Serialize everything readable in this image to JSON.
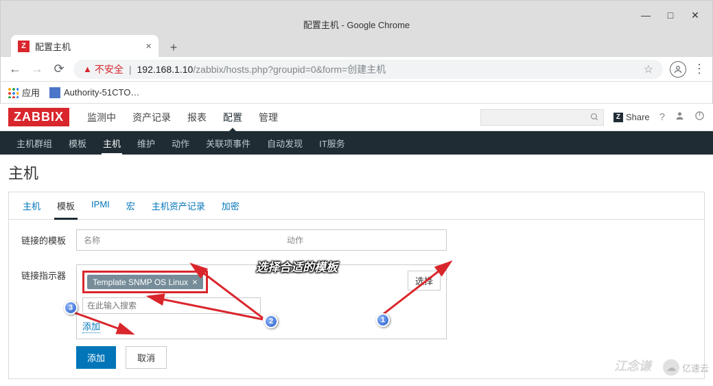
{
  "chrome": {
    "window_title": "配置主机 - Google Chrome",
    "tab_title": "配置主机",
    "tab_favicon_letter": "Z",
    "insecure_label": "不安全",
    "url_host": "192.168.1.10",
    "url_path": "/zabbix/hosts.php?groupid=0&form=创建主机",
    "apps_label": "应用",
    "bookmark_1": "Authority-51CTO…"
  },
  "zabbix": {
    "logo": "ZABBIX",
    "top_menu": [
      "监测中",
      "资产记录",
      "报表",
      "配置",
      "管理"
    ],
    "top_menu_active_index": 3,
    "share_label": "Share",
    "sub_menu": [
      "主机群组",
      "模板",
      "主机",
      "维护",
      "动作",
      "关联项事件",
      "自动发现",
      "IT服务"
    ],
    "sub_menu_active_index": 2,
    "page_title": "主机",
    "card_tabs": [
      "主机",
      "模板",
      "IPMI",
      "宏",
      "主机资产记录",
      "加密"
    ],
    "card_tabs_active_index": 1,
    "linked_label": "链接的模板",
    "linked_cols": {
      "name": "名称",
      "action": "动作"
    },
    "indicator_label": "链接指示器",
    "template_tag": "Template SNMP OS Linux",
    "search_placeholder": "在此输入搜索",
    "select_btn": "选择",
    "add_link": "添加",
    "add_btn": "添加",
    "cancel_btn": "取消"
  },
  "annot": {
    "hint_text": "选择合适的模板",
    "badges": [
      "1",
      "2",
      "3"
    ]
  },
  "watermark": {
    "brand": "亿速云",
    "signature": "江念谦"
  }
}
